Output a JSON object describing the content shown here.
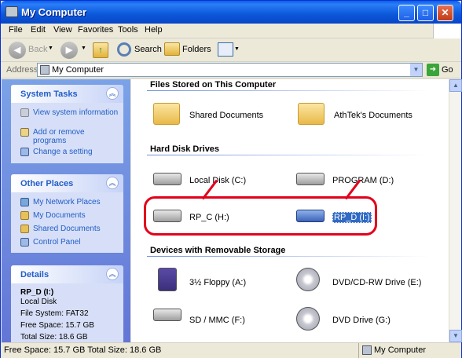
{
  "window": {
    "title": "My Computer"
  },
  "menu": [
    "File",
    "Edit",
    "View",
    "Favorites",
    "Tools",
    "Help"
  ],
  "toolbar": {
    "back": "Back",
    "search": "Search",
    "folders": "Folders"
  },
  "address": {
    "label": "Address",
    "value": "My Computer",
    "go": "Go"
  },
  "tasks": {
    "system": {
      "title": "System Tasks",
      "items": [
        "View system information",
        "Add or remove programs",
        "Change a setting"
      ]
    },
    "other": {
      "title": "Other Places",
      "items": [
        "My Network Places",
        "My Documents",
        "Shared Documents",
        "Control Panel"
      ]
    },
    "details": {
      "title": "Details",
      "name": "RP_D (I:)",
      "type": "Local Disk",
      "fs": "File System: FAT32",
      "free": "Free Space: 15.7 GB",
      "total": "Total Size: 18.6 GB"
    }
  },
  "sections": {
    "files": {
      "title": "Files Stored on This Computer",
      "items": [
        "Shared Documents",
        "AthTek's Documents"
      ]
    },
    "hdd": {
      "title": "Hard Disk Drives",
      "items": [
        "Local Disk (C:)",
        "PROGRAM (D:)",
        "RP_C (H:)",
        "RP_D (I:)"
      ]
    },
    "removable": {
      "title": "Devices with Removable Storage",
      "items": [
        "3½ Floppy (A:)",
        "DVD/CD-RW Drive (E:)",
        "SD / MMC (F:)",
        "DVD Drive (G:)"
      ]
    }
  },
  "status": {
    "left": "Free Space: 15.7 GB Total Size: 18.6 GB",
    "right": "My Computer"
  }
}
